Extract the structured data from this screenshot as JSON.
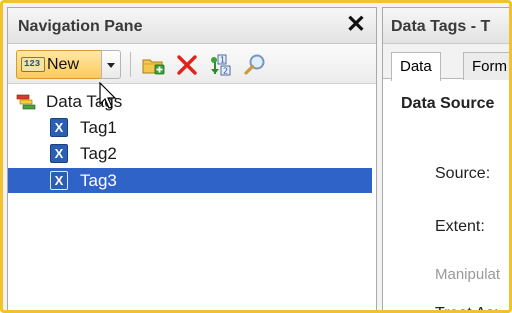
{
  "nav_pane": {
    "title": "Navigation Pane",
    "close_glyph": "✕",
    "toolbar": {
      "new_label": "New",
      "new_icon_text": "123",
      "icons": [
        "new-folder-icon",
        "delete-icon",
        "sort-icon",
        "find-icon"
      ]
    },
    "tree": {
      "root": {
        "label": "Data Tags",
        "icon": "data-tags-icon"
      },
      "items": [
        {
          "label": "Tag1",
          "icon_glyph": "X",
          "selected": false
        },
        {
          "label": "Tag2",
          "icon_glyph": "X",
          "selected": false
        },
        {
          "label": "Tag3",
          "icon_glyph": "X",
          "selected": true
        }
      ]
    }
  },
  "detail_pane": {
    "title": "Data Tags - T",
    "tabs": [
      {
        "label": "Data",
        "active": true
      },
      {
        "label": "Form",
        "active": false
      }
    ],
    "section_title": "Data Source",
    "fields": [
      {
        "label": "Source:",
        "enabled": true
      },
      {
        "label": "Extent:",
        "enabled": true
      },
      {
        "label": "Manipulat",
        "enabled": false
      },
      {
        "label": "Treat As:",
        "enabled": true
      }
    ]
  },
  "colors": {
    "frame_accent": "#f2c12e",
    "selection": "#2f63c7",
    "new_button": "#ffc95b"
  }
}
